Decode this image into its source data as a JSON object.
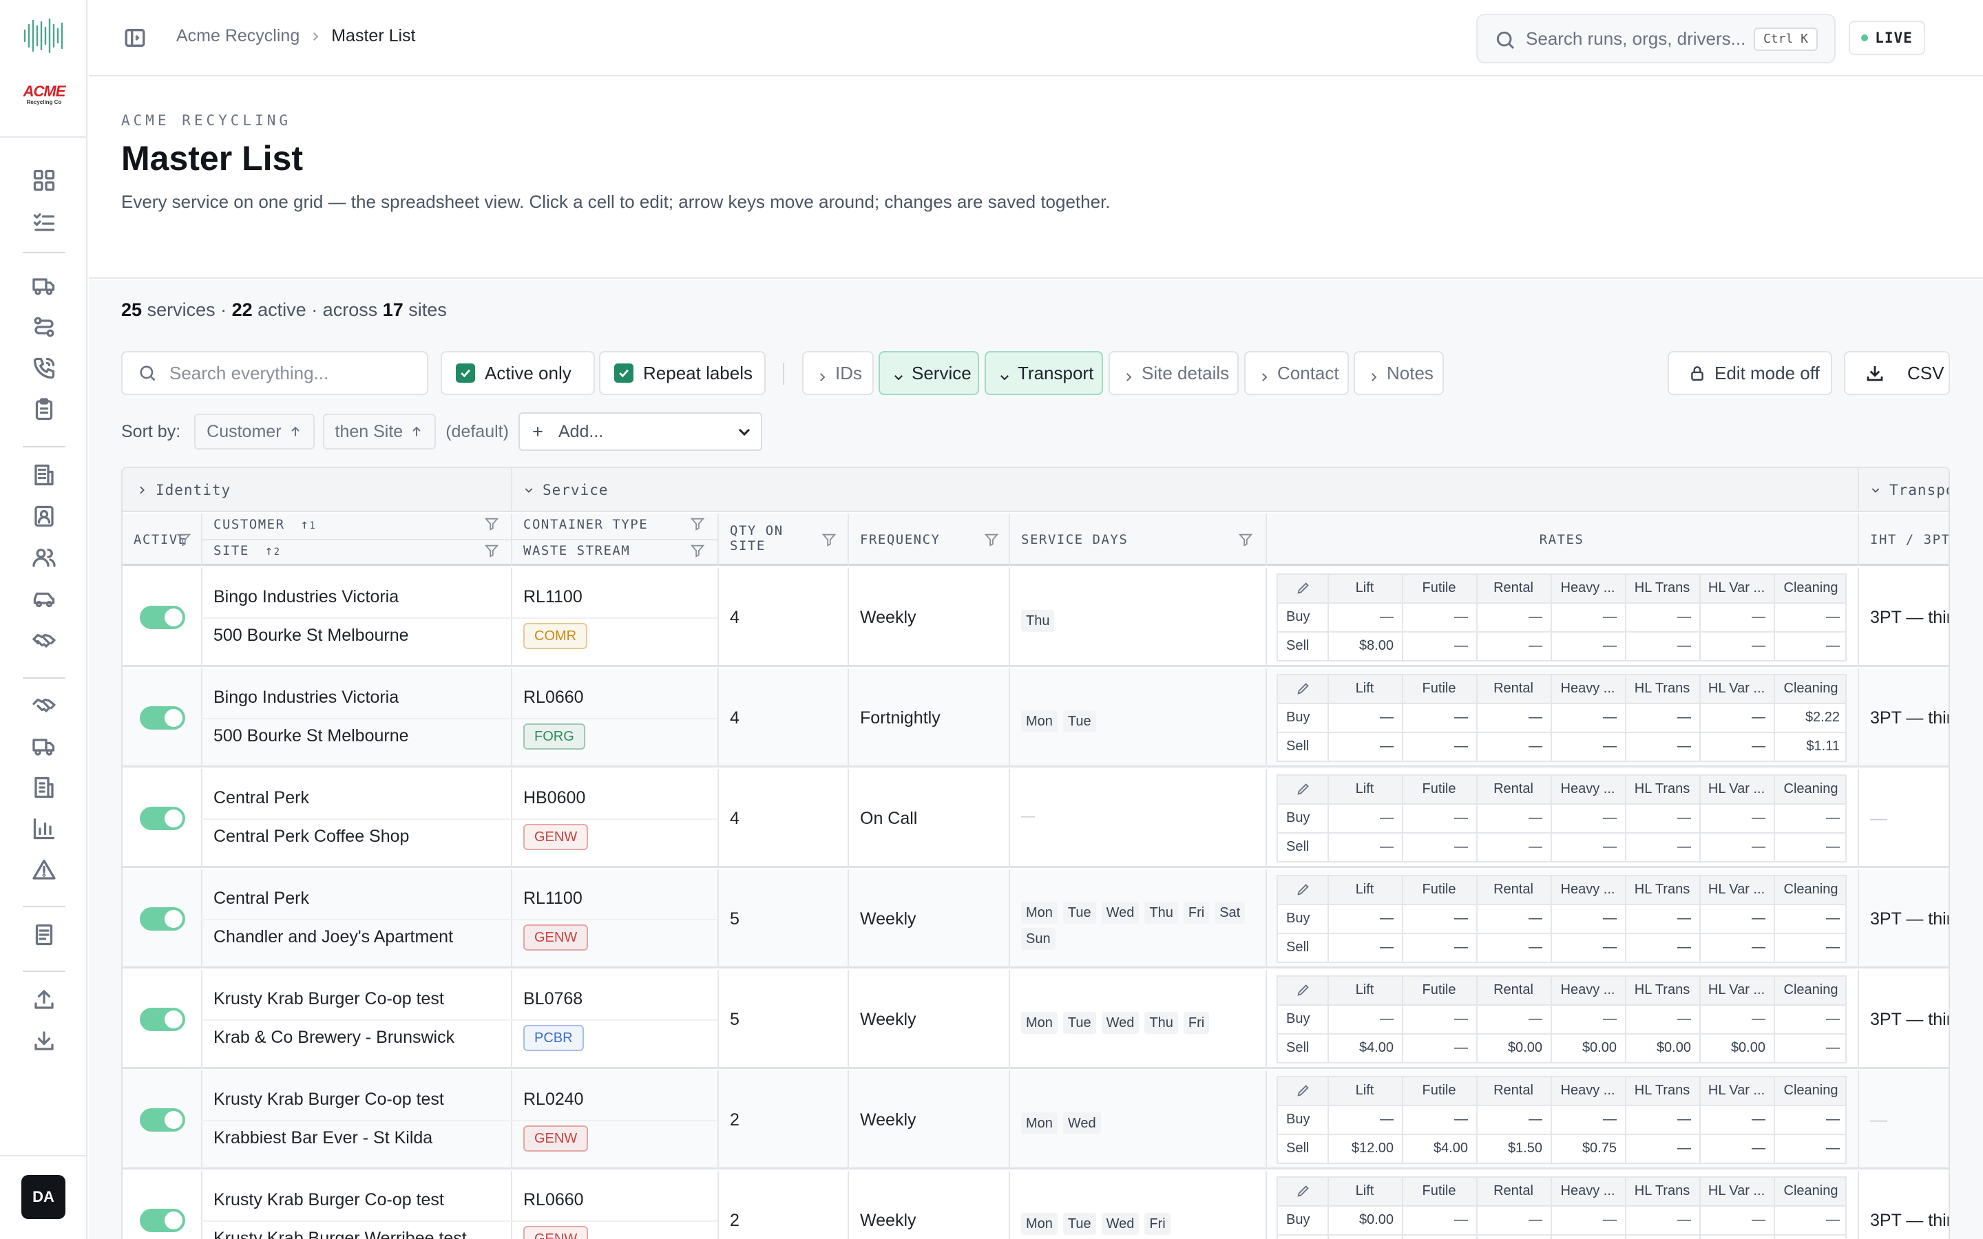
{
  "app": {
    "brand": "ACME",
    "brand_sub": "Recycling Co",
    "user_initials": "DA"
  },
  "breadcrumb": {
    "org": "Acme Recycling",
    "page": "Master List"
  },
  "search": {
    "placeholder": "Search runs, orgs, drivers...",
    "shortcut": "Ctrl K"
  },
  "live_label": "LIVE",
  "header": {
    "eyebrow": "ACME RECYCLING",
    "title": "Master List",
    "description": "Every service on one grid — the spreadsheet view. Click a cell to edit; arrow keys move around; changes are saved together."
  },
  "summary": {
    "services": "25",
    "services_label": "services ·",
    "active": "22",
    "active_label": "active · across",
    "sites": "17",
    "sites_label": "sites"
  },
  "toolbar": {
    "search_placeholder": "Search everything...",
    "active_only": "Active only",
    "repeat_labels": "Repeat labels",
    "ids": "IDs",
    "service": "Service",
    "transport": "Transport",
    "site_details": "Site details",
    "contact": "Contact",
    "notes": "Notes",
    "edit_mode": "Edit mode off",
    "csv": "CSV"
  },
  "sort": {
    "label": "Sort by:",
    "first": "Customer",
    "second": "then Site",
    "default": "(default)",
    "add": "Add..."
  },
  "groups": {
    "identity": "Identity",
    "service": "Service",
    "transport": "Transpo"
  },
  "columns": {
    "active": "ACTIVE",
    "customer": "CUSTOMER",
    "customer_sort": "1",
    "site": "SITE",
    "site_sort": "2",
    "container": "CONTAINER TYPE",
    "waste": "WASTE STREAM",
    "qty1": "QTY ON",
    "qty2": "SITE",
    "frequency": "FREQUENCY",
    "days": "SERVICE DAYS",
    "rates": "RATES",
    "iht": "IHT / 3PT"
  },
  "rate_cols": [
    "Lift",
    "Futile",
    "Rental",
    "Heavy ...",
    "HL Trans",
    "HL Var ...",
    "Cleaning"
  ],
  "rate_rows": [
    "Buy",
    "Sell"
  ],
  "rows": [
    {
      "customer": "Bingo Industries Victoria",
      "site": "500 Bourke St Melbourne",
      "container": "RL1100",
      "waste": "COMR",
      "qty": "4",
      "frequency": "Weekly",
      "days": [
        "Thu"
      ],
      "buy": [
        "—",
        "—",
        "—",
        "—",
        "—",
        "—",
        "—"
      ],
      "sell": [
        "$8.00",
        "—",
        "—",
        "—",
        "—",
        "—",
        "—"
      ],
      "iht": "3PT — thir"
    },
    {
      "customer": "Bingo Industries Victoria",
      "site": "500 Bourke St Melbourne",
      "container": "RL0660",
      "waste": "FORG",
      "qty": "4",
      "frequency": "Fortnightly",
      "days": [
        "Mon",
        "Tue"
      ],
      "buy": [
        "—",
        "—",
        "—",
        "—",
        "—",
        "—",
        "$2.22"
      ],
      "sell": [
        "—",
        "—",
        "—",
        "—",
        "—",
        "—",
        "$1.11"
      ],
      "iht": "3PT — thir"
    },
    {
      "customer": "Central Perk",
      "site": "Central Perk Coffee Shop",
      "container": "HB0600",
      "waste": "GENW",
      "qty": "4",
      "frequency": "On Call",
      "days": [],
      "buy": [
        "—",
        "—",
        "—",
        "—",
        "—",
        "—",
        "—"
      ],
      "sell": [
        "—",
        "—",
        "—",
        "—",
        "—",
        "—",
        "—"
      ],
      "iht": "—"
    },
    {
      "customer": "Central Perk",
      "site": "Chandler and Joey's Apartment",
      "container": "RL1100",
      "waste": "GENW",
      "qty": "5",
      "frequency": "Weekly",
      "days": [
        "Mon",
        "Tue",
        "Wed",
        "Thu",
        "Fri",
        "Sat",
        "Sun"
      ],
      "buy": [
        "—",
        "—",
        "—",
        "—",
        "—",
        "—",
        "—"
      ],
      "sell": [
        "—",
        "—",
        "—",
        "—",
        "—",
        "—",
        "—"
      ],
      "iht": "3PT — thir"
    },
    {
      "customer": "Krusty Krab Burger Co-op test",
      "site": "Krab & Co Brewery - Brunswick",
      "container": "BL0768",
      "waste": "PCBR",
      "qty": "5",
      "frequency": "Weekly",
      "days": [
        "Mon",
        "Tue",
        "Wed",
        "Thu",
        "Fri"
      ],
      "buy": [
        "—",
        "—",
        "—",
        "—",
        "—",
        "—",
        "—"
      ],
      "sell": [
        "$4.00",
        "—",
        "$0.00",
        "$0.00",
        "$0.00",
        "$0.00",
        "—"
      ],
      "iht": "3PT — thir"
    },
    {
      "customer": "Krusty Krab Burger Co-op test",
      "site": "Krabbiest Bar Ever - St Kilda",
      "container": "RL0240",
      "waste": "GENW",
      "qty": "2",
      "frequency": "Weekly",
      "days": [
        "Mon",
        "Wed"
      ],
      "buy": [
        "—",
        "—",
        "—",
        "—",
        "—",
        "—",
        "—"
      ],
      "sell": [
        "$12.00",
        "$4.00",
        "$1.50",
        "$0.75",
        "—",
        "—",
        "—"
      ],
      "iht": "—"
    },
    {
      "customer": "Krusty Krab Burger Co-op test",
      "site": "Krusty Krab Burger Werribee test",
      "container": "RL0660",
      "waste": "GENW",
      "qty": "2",
      "frequency": "Weekly",
      "days": [
        "Mon",
        "Tue",
        "Wed",
        "Fri"
      ],
      "buy": [
        "$0.00",
        "—",
        "—",
        "—",
        "—",
        "—",
        "—"
      ],
      "sell": [
        "—",
        "—",
        "—",
        "—",
        "—",
        "—",
        "—"
      ],
      "iht": "3PT — thir"
    }
  ],
  "waste_colors": {
    "COMR": "#c98a12",
    "FORG": "#2f8a57",
    "GENW": "#c9413b",
    "PCBR": "#3b6fc9"
  }
}
